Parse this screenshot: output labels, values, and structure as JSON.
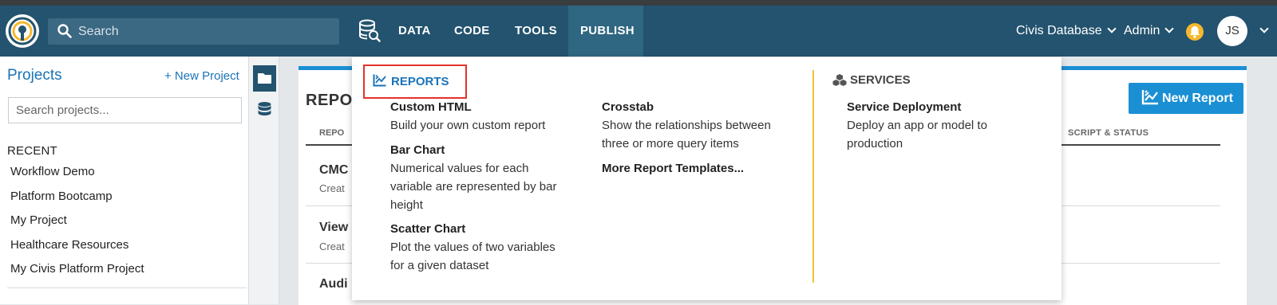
{
  "navbar": {
    "search_placeholder": "Search",
    "links": [
      "DATA",
      "CODE",
      "TOOLS",
      "PUBLISH"
    ],
    "active_link": "PUBLISH",
    "database_label": "Civis Database",
    "admin_label": "Admin",
    "avatar_initials": "JS"
  },
  "sidebar": {
    "title": "Projects",
    "new_project_label": "+ New Project",
    "search_placeholder": "Search projects...",
    "recent_heading": "RECENT",
    "recent_items": [
      "Workflow Demo",
      "Platform Bootcamp",
      "My Project",
      "Healthcare Resources",
      "My Civis Platform Project"
    ]
  },
  "main": {
    "title": "REPO",
    "new_report_label": "New Report",
    "col_left": "REPO",
    "col_right": "SCRIPT & STATUS",
    "rows": [
      {
        "title": "CMC",
        "sub": "Creat"
      },
      {
        "title": "View",
        "sub": "Creat"
      },
      {
        "title": "Audi",
        "sub": ""
      }
    ]
  },
  "dropdown": {
    "reports_heading": "REPORTS",
    "services_heading": "SERVICES",
    "col1": [
      {
        "title": "Custom HTML",
        "desc": "Build your own custom report"
      },
      {
        "title": "Bar Chart",
        "desc": "Numerical values for each variable are represented by bar height"
      },
      {
        "title": "Scatter Chart",
        "desc": "Plot the values of two variables for a given dataset"
      }
    ],
    "col2": [
      {
        "title": "Crosstab",
        "desc": "Show the relationships between three or more query items"
      },
      {
        "title": "More Report Templates...",
        "desc": ""
      }
    ],
    "col3": [
      {
        "title": "Service Deployment",
        "desc": "Deploy an app or model to production"
      }
    ]
  },
  "colors": {
    "navbar": "#23536e",
    "accent_blue": "#1b8fd4",
    "link_blue": "#1a73b8",
    "highlight_red": "#e4322b",
    "divider_yellow": "#f5c236",
    "bell_yellow": "#f5b82e"
  }
}
